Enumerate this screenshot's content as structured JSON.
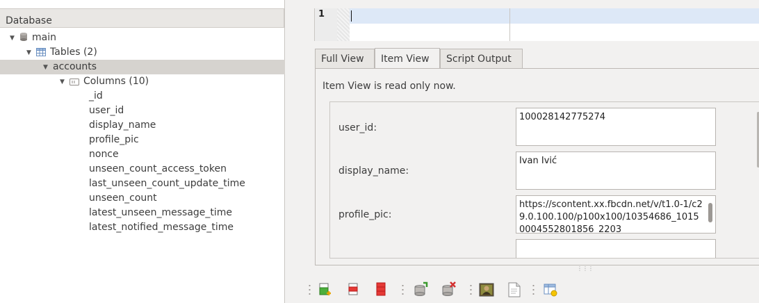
{
  "tree": {
    "header": "Database",
    "db_name": "main",
    "tables_label": "Tables (2)",
    "table_name": "accounts",
    "columns_label": "Columns (10)",
    "columns": [
      "_id",
      "user_id",
      "display_name",
      "profile_pic",
      "nonce",
      "unseen_count_access_token",
      "last_unseen_count_update_time",
      "unseen_count",
      "latest_unseen_message_time",
      "latest_notified_message_time"
    ]
  },
  "editor": {
    "line_number": "1"
  },
  "tabs": {
    "full_view": "Full View",
    "item_view": "Item View",
    "script_output": "Script Output",
    "active": "Item View"
  },
  "item_view": {
    "readonly_message": "Item View is read only now.",
    "fields": [
      {
        "label": "user_id:",
        "value": "100028142775274"
      },
      {
        "label": "display_name:",
        "value": "Ivan Ivić"
      },
      {
        "label": "profile_pic:",
        "value": "https://scontent.xx.fbcdn.net/v/t1.0-1/c29.0.100.100/p100x100/10354686_10150004552801856_2203"
      }
    ]
  },
  "toolbar": {
    "icons": [
      "insert-row-icon",
      "delete-row-icon",
      "truncate-icon",
      "commit-icon",
      "rollback-icon",
      "image-icon",
      "export-icon",
      "table-info-icon"
    ]
  },
  "colors": {
    "selected_row": "#d6d3cf",
    "current_line": "#dde8f7",
    "panel_bg": "#f2f1f0"
  }
}
